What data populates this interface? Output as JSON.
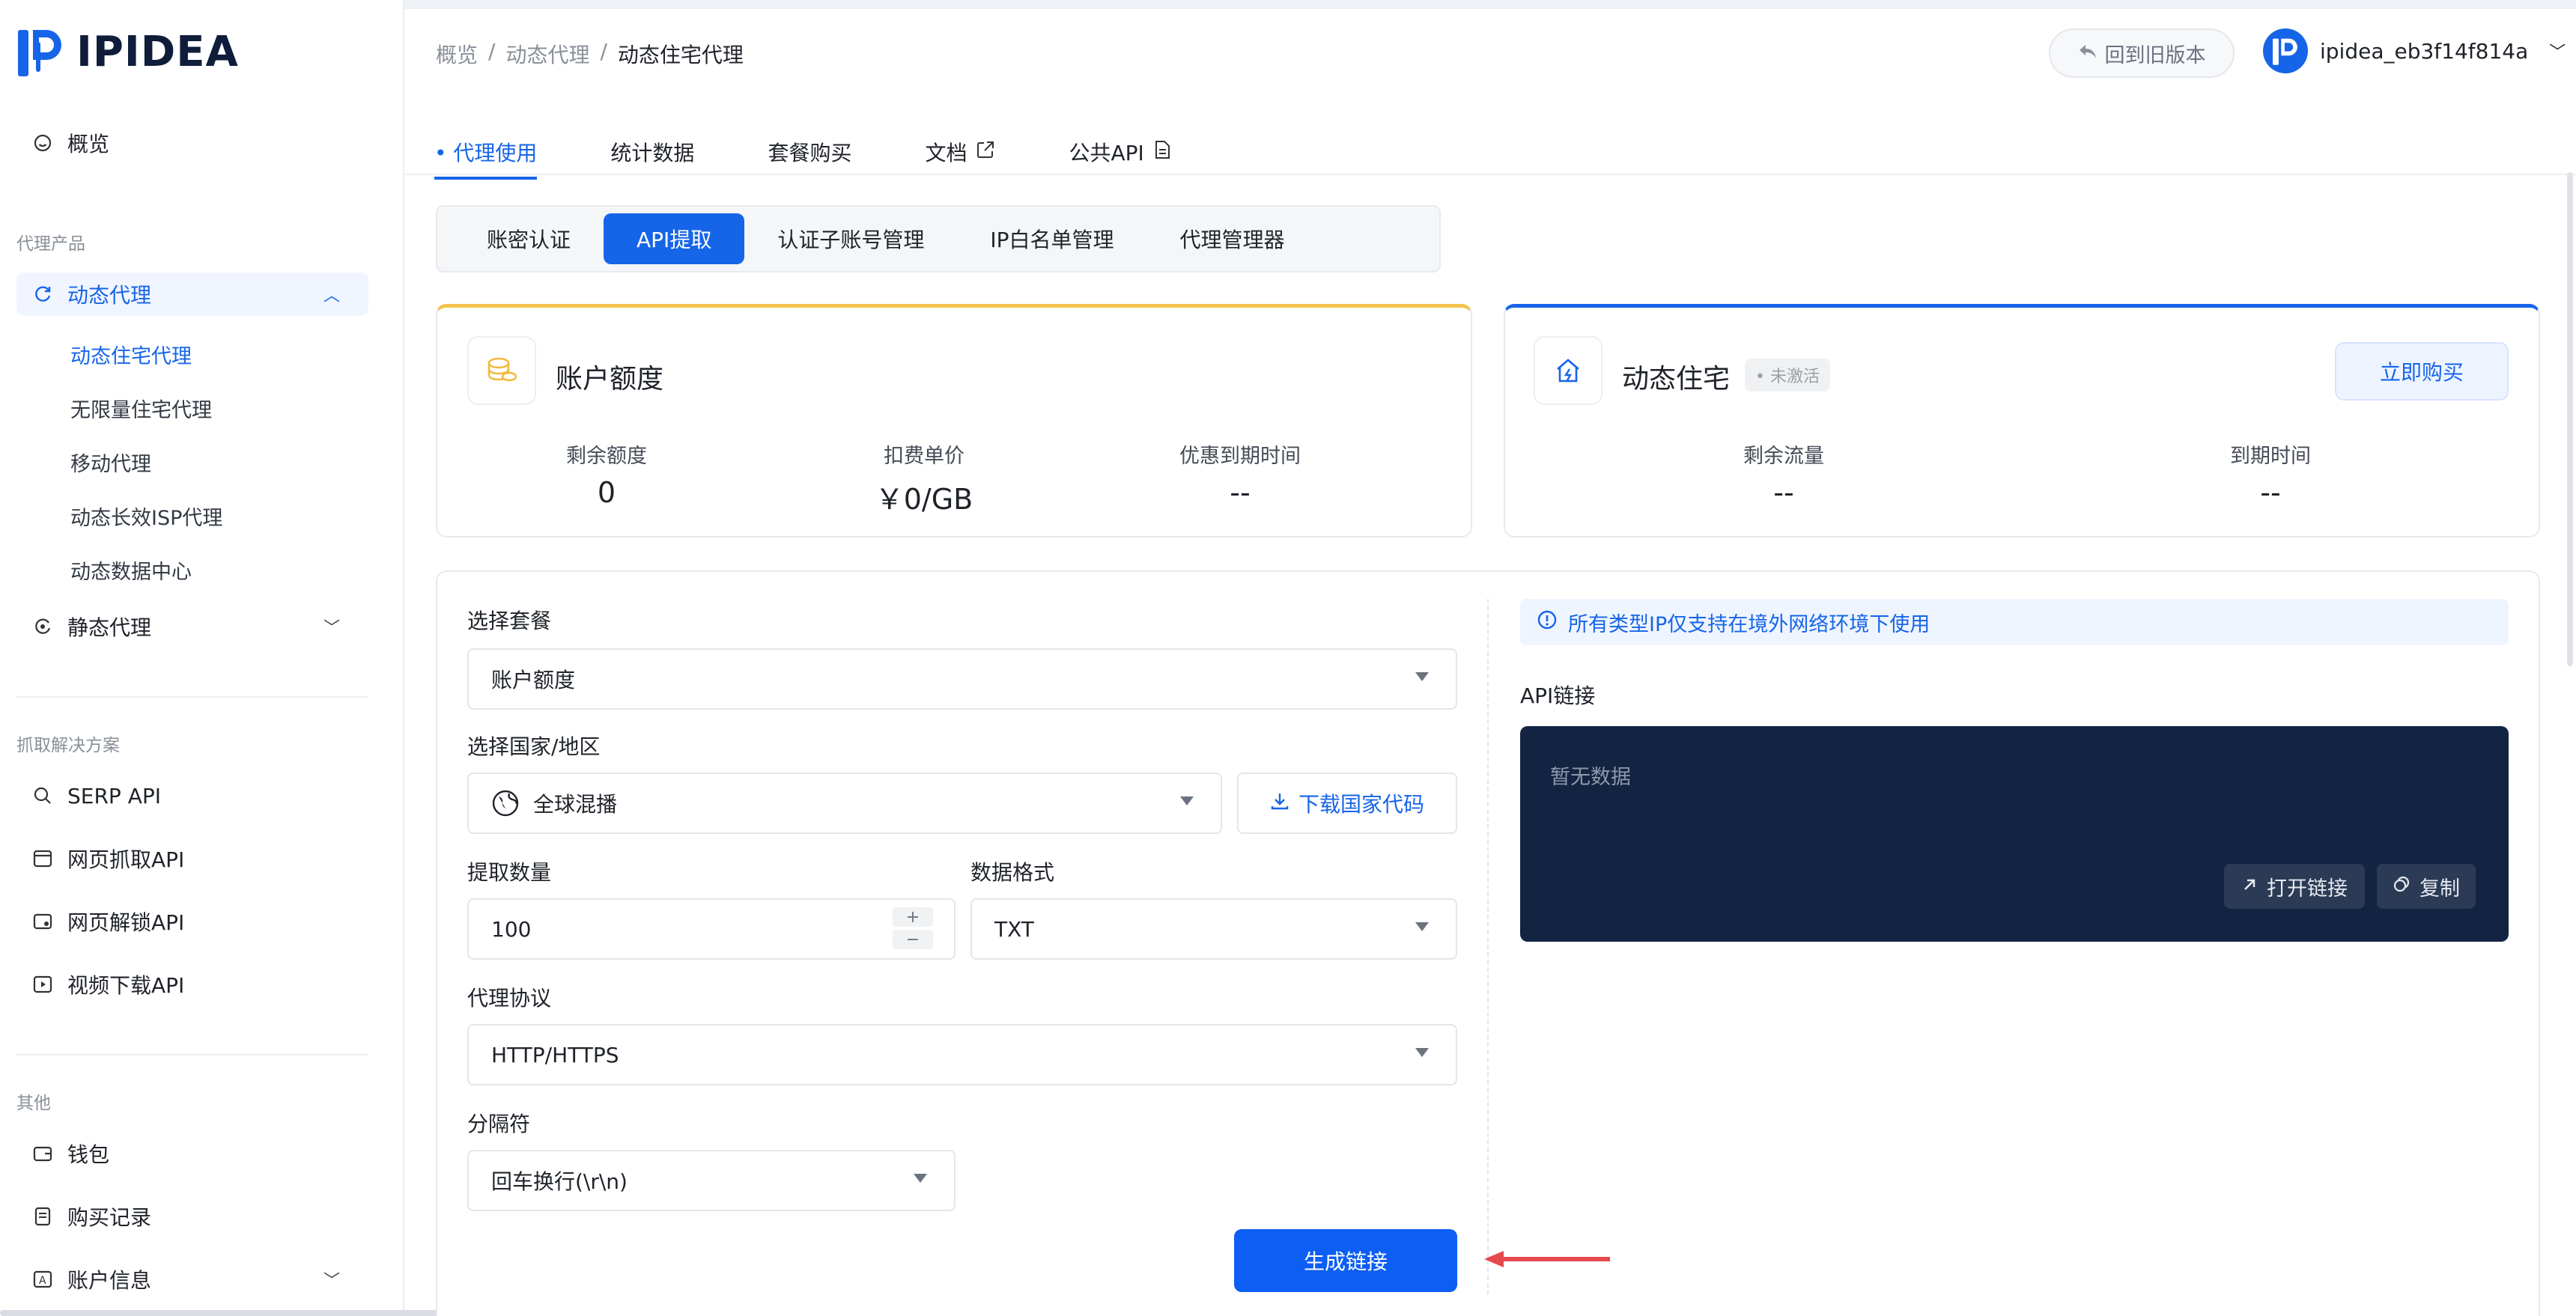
{
  "app": {
    "brand": "IPIDEA"
  },
  "sidebar": {
    "overview": "概览",
    "group_proxy": "代理产品",
    "dynamic_proxy": "动态代理",
    "sub": [
      "动态住宅代理",
      "无限量住宅代理",
      "移动代理",
      "动态长效ISP代理",
      "动态数据中心"
    ],
    "static_proxy": "静态代理",
    "group_scrape": "抓取解决方案",
    "scrape": [
      "SERP API",
      "网页抓取API",
      "网页解锁API",
      "视频下载API"
    ],
    "group_other": "其他",
    "other": [
      "钱包",
      "购买记录",
      "账户信息"
    ]
  },
  "header": {
    "breadcrumb": [
      "概览",
      "/",
      "动态代理",
      "/",
      "动态住宅代理"
    ],
    "back_label": "回到旧版本",
    "username": "ipidea_eb3f14f814a"
  },
  "tabs": [
    "• 代理使用",
    "统计数据",
    "套餐购买",
    "文档",
    "公共API"
  ],
  "segments": [
    "账密认证",
    "API提取",
    "认证子账号管理",
    "IP白名单管理",
    "代理管理器"
  ],
  "account_card": {
    "title": "账户额度",
    "stats": [
      {
        "label": "剩余额度",
        "value": "0"
      },
      {
        "label": "扣费单价",
        "value": "￥0/GB"
      },
      {
        "label": "优惠到期时间",
        "value": "--"
      }
    ]
  },
  "residential_card": {
    "title": "动态住宅",
    "badge": "• 未激活",
    "buy_label": "立即购买",
    "stats": [
      {
        "label": "剩余流量",
        "value": "--"
      },
      {
        "label": "到期时间",
        "value": "--"
      }
    ]
  },
  "form": {
    "package_label": "选择套餐",
    "package_value": "账户额度",
    "country_label": "选择国家/地区",
    "country_value": "全球混播",
    "download_label": "下载国家代码",
    "quantity_label": "提取数量",
    "quantity_value": "100",
    "format_label": "数据格式",
    "format_value": "TXT",
    "protocol_label": "代理协议",
    "protocol_value": "HTTP/HTTPS",
    "separator_label": "分隔符",
    "separator_value": "回车换行(\\r\\n)",
    "generate_label": "生成链接",
    "stepper_plus": "+",
    "stepper_minus": "−"
  },
  "api": {
    "notice": "所有类型IP仅支持在境外网络环境下使用",
    "label": "API链接",
    "empty": "暂无数据",
    "open_label": "打开链接",
    "copy_label": "复制"
  },
  "colors": {
    "accent": "#1665e8",
    "dark_panel": "#132442",
    "warning_border": "#f3c24a",
    "arrow": "#e5484d"
  }
}
